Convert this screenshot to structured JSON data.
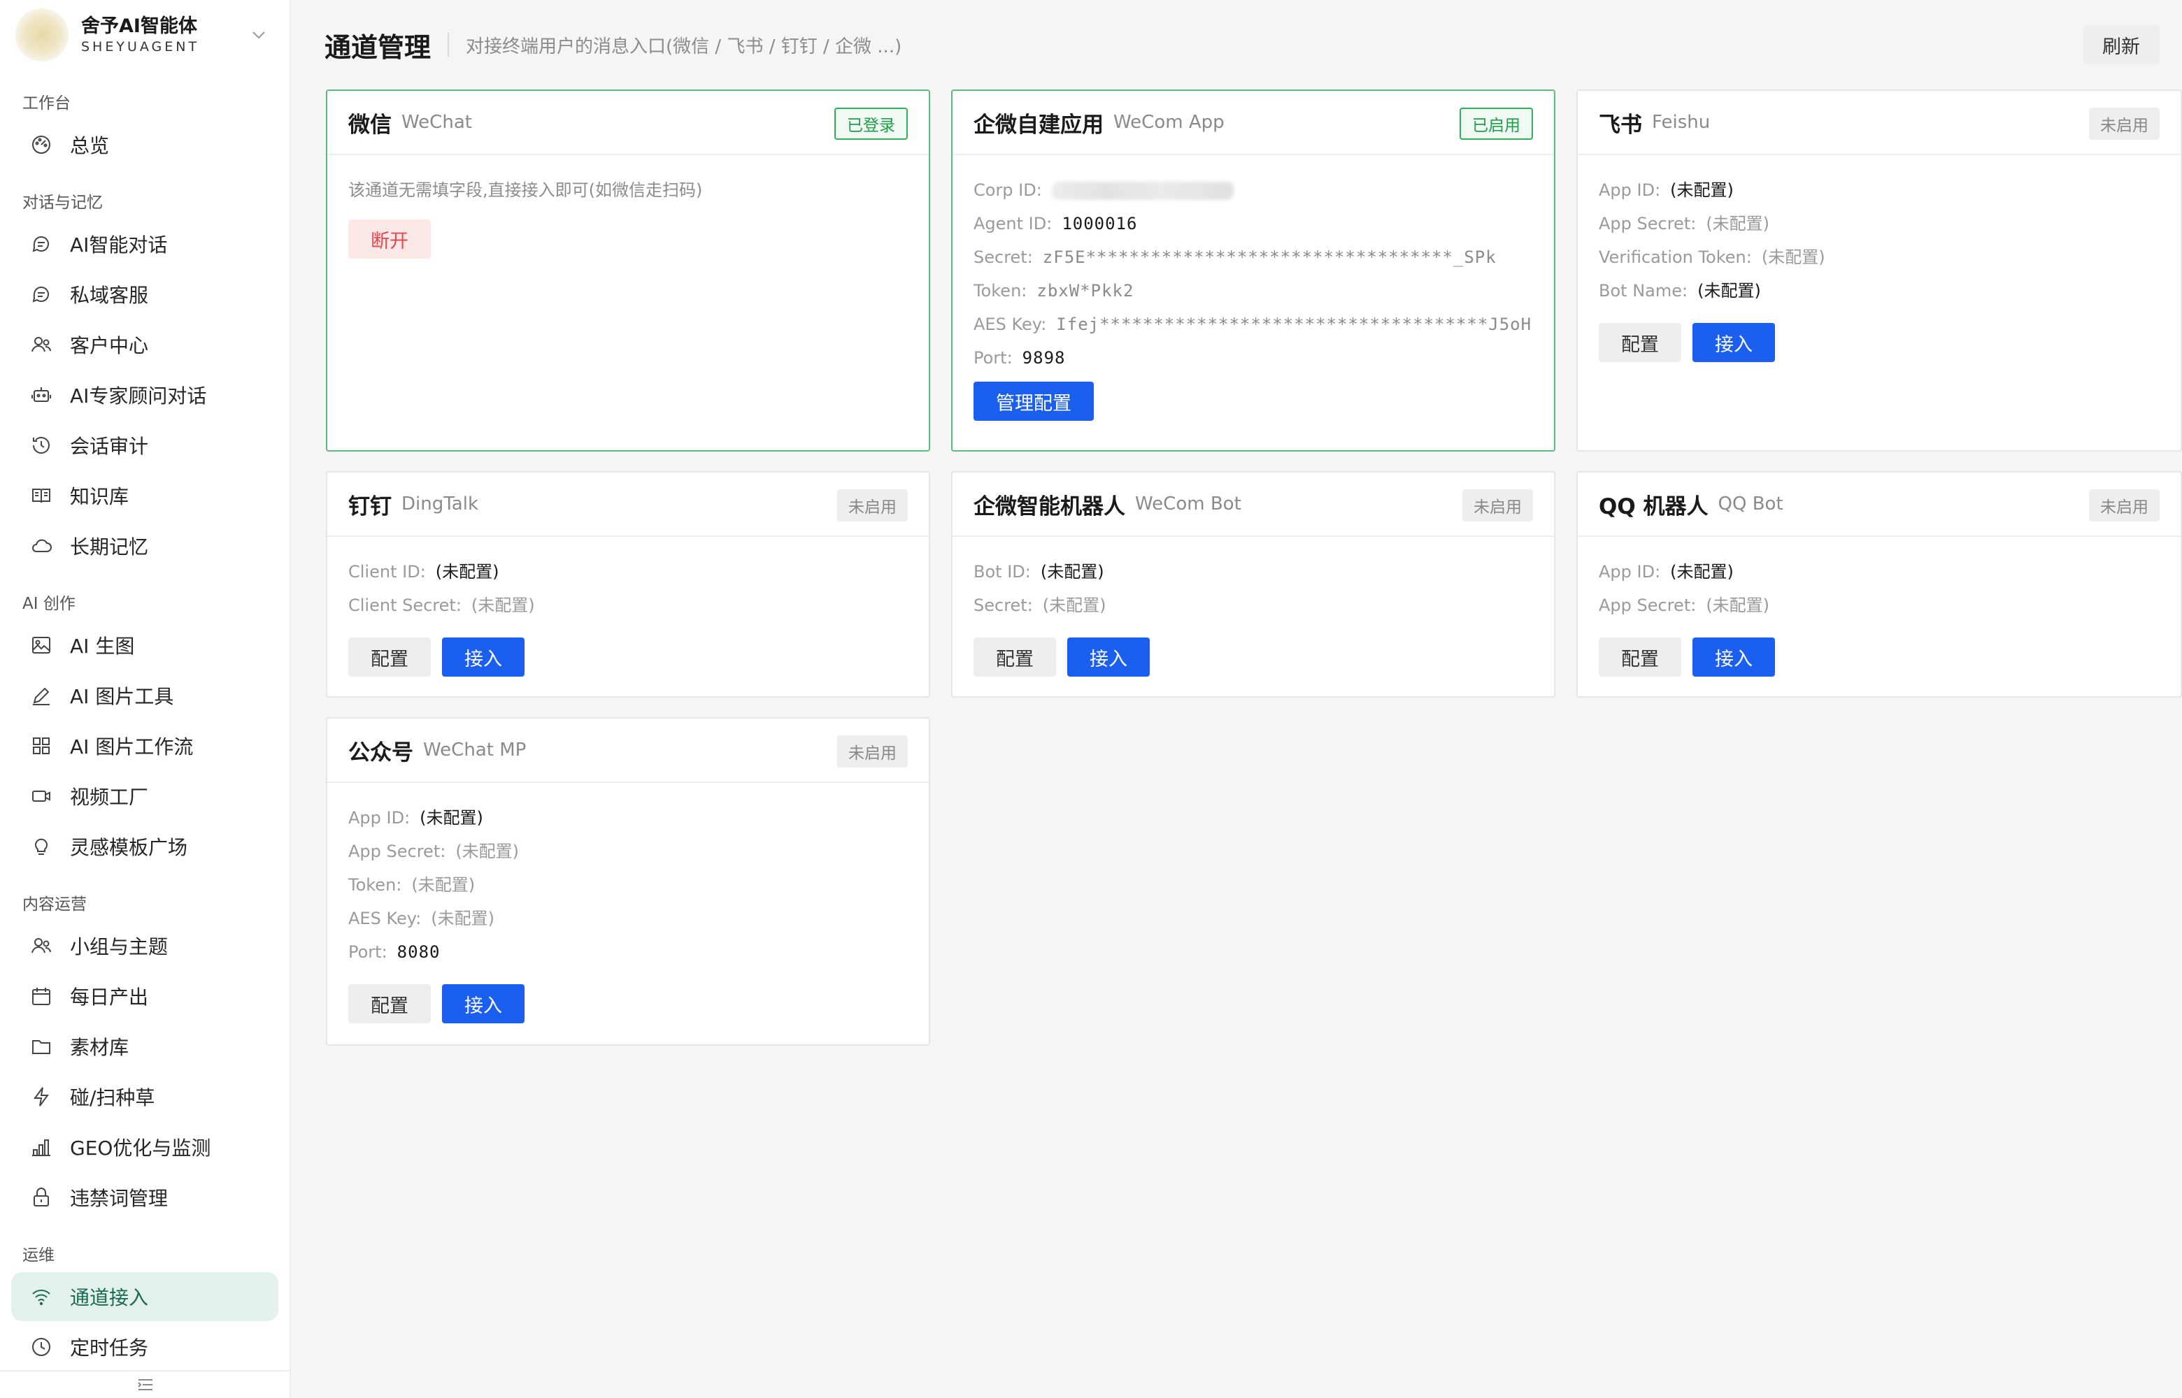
{
  "brand": {
    "name": "舍予AI智能体",
    "sub": "SHEYUAGENT"
  },
  "sidebar": {
    "groups": [
      {
        "label": "工作台",
        "items": [
          {
            "label": "总览",
            "icon": "dashboard-icon"
          }
        ]
      },
      {
        "label": "对话与记忆",
        "items": [
          {
            "label": "AI智能对话",
            "icon": "chat-icon"
          },
          {
            "label": "私域客服",
            "icon": "chat-icon"
          },
          {
            "label": "客户中心",
            "icon": "users-icon"
          },
          {
            "label": "AI专家顾问对话",
            "icon": "robot-icon"
          },
          {
            "label": "会话审计",
            "icon": "history-icon"
          },
          {
            "label": "知识库",
            "icon": "book-icon"
          },
          {
            "label": "长期记忆",
            "icon": "cloud-icon"
          }
        ]
      },
      {
        "label": "AI 创作",
        "items": [
          {
            "label": "AI 生图",
            "icon": "image-icon"
          },
          {
            "label": "AI 图片工具",
            "icon": "pen-icon"
          },
          {
            "label": "AI 图片工作流",
            "icon": "grid-icon"
          },
          {
            "label": "视频工厂",
            "icon": "video-icon"
          },
          {
            "label": "灵感模板广场",
            "icon": "bulb-icon"
          }
        ]
      },
      {
        "label": "内容运营",
        "items": [
          {
            "label": "小组与主题",
            "icon": "users-icon"
          },
          {
            "label": "每日产出",
            "icon": "calendar-icon"
          },
          {
            "label": "素材库",
            "icon": "folder-icon"
          },
          {
            "label": "碰/扫种草",
            "icon": "bolt-icon"
          },
          {
            "label": "GEO优化与监测",
            "icon": "bar-chart-icon"
          },
          {
            "label": "违禁词管理",
            "icon": "lock-icon"
          }
        ]
      },
      {
        "label": "运维",
        "items": [
          {
            "label": "通道接入",
            "icon": "wifi-icon",
            "active": true
          },
          {
            "label": "定时任务",
            "icon": "clock-icon"
          }
        ]
      }
    ]
  },
  "header": {
    "title": "通道管理",
    "subtitle": "对接终端用户的消息入口(微信 / 飞书 / 钉钉 / 企微 ...)",
    "refresh": "刷新"
  },
  "cards": {
    "wechat": {
      "title": "微信",
      "en": "WeChat",
      "badge": "已登录",
      "note": "该通道无需填字段,直接接入即可(如微信走扫码)",
      "disconnect": "断开"
    },
    "wecom_app": {
      "title": "企微自建应用",
      "en": "WeCom App",
      "badge": "已启用",
      "corp_id_label": "Corp ID:",
      "agent_id_label": "Agent ID:",
      "agent_id": "1000016",
      "secret_label": "Secret:",
      "secret": "zF5E**********************************_SPk",
      "token_label": "Token:",
      "token": "zbxW*Pkk2",
      "aes_label": "AES Key:",
      "aes": "Ifej************************************J5oH",
      "port_label": "Port:",
      "port": "9898",
      "manage": "管理配置"
    },
    "feishu": {
      "title": "飞书",
      "en": "Feishu",
      "badge": "未启用",
      "app_id_label": "App ID:",
      "app_id": "(未配置)",
      "app_secret_label": "App Secret:",
      "app_secret": "(未配置)",
      "vtoken_label": "Verification Token:",
      "vtoken": "(未配置)",
      "bot_name_label": "Bot Name:",
      "bot_name": "(未配置)",
      "config": "配置",
      "connect": "接入"
    },
    "dingtalk": {
      "title": "钉钉",
      "en": "DingTalk",
      "badge": "未启用",
      "client_id_label": "Client ID:",
      "client_id": "(未配置)",
      "client_secret_label": "Client Secret:",
      "client_secret": "(未配置)",
      "config": "配置",
      "connect": "接入"
    },
    "wecom_bot": {
      "title": "企微智能机器人",
      "en": "WeCom Bot",
      "badge": "未启用",
      "bot_id_label": "Bot ID:",
      "bot_id": "(未配置)",
      "secret_label": "Secret:",
      "secret": "(未配置)",
      "config": "配置",
      "connect": "接入"
    },
    "qq_bot": {
      "title": "QQ 机器人",
      "en": "QQ Bot",
      "badge": "未启用",
      "app_id_label": "App ID:",
      "app_id": "(未配置)",
      "app_secret_label": "App Secret:",
      "app_secret": "(未配置)",
      "config": "配置",
      "connect": "接入"
    },
    "wechat_mp": {
      "title": "公众号",
      "en": "WeChat MP",
      "badge": "未启用",
      "app_id_label": "App ID:",
      "app_id": "(未配置)",
      "app_secret_label": "App Secret:",
      "app_secret": "(未配置)",
      "token_label": "Token:",
      "token": "(未配置)",
      "aes_label": "AES Key:",
      "aes": "(未配置)",
      "port_label": "Port:",
      "port": "8080",
      "config": "配置",
      "connect": "接入"
    }
  }
}
